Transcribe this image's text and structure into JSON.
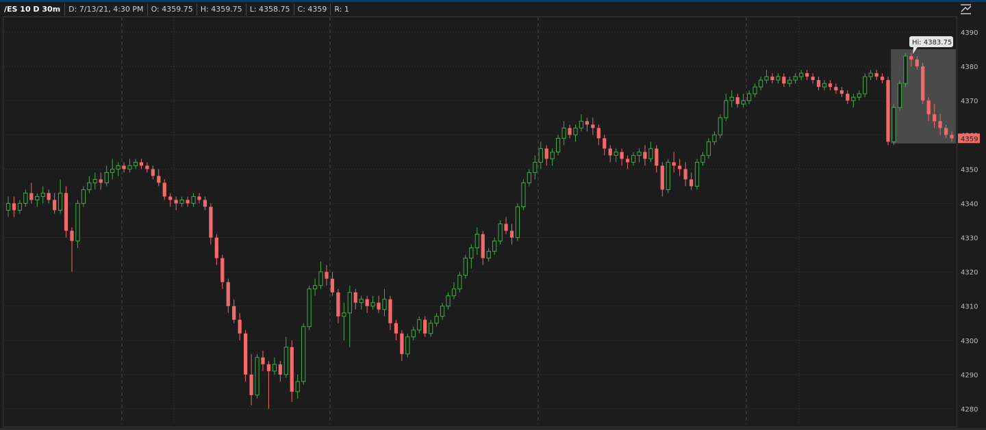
{
  "header": {
    "symbol": "/ES 10 D 30m",
    "date": "D: 7/13/21, 4:30 PM",
    "open": "O: 4359.75",
    "high": "H: 4359.75",
    "low": "L: 4358.75",
    "close": "C: 4359",
    "range": "R: 1"
  },
  "icons": {
    "corner": "chart-settings-icon"
  },
  "colors": {
    "background": "#1c1c1c",
    "up": "#3cb043",
    "down": "#f06a6a",
    "grid": "#3c3c3c",
    "highlight": "#5a5a5a"
  },
  "hi_label": "Hi: 4383.75",
  "last_price_label": "4359",
  "chart_data": {
    "type": "candlestick",
    "title": "/ES 10 D 30m",
    "ylim": [
      4278,
      4393
    ],
    "y_ticks": [
      "4390",
      "4380",
      "4370",
      "4360",
      "4350",
      "4340",
      "4330",
      "4320",
      "4310",
      "4300",
      "4290",
      "4280"
    ],
    "grid": "dotted horizontal, dashed vertical day separators",
    "candles": [
      [
        4338,
        4342,
        4336,
        4340
      ],
      [
        4340,
        4342,
        4336,
        4338
      ],
      [
        4338,
        4341,
        4337,
        4340
      ],
      [
        4340,
        4344,
        4339,
        4343
      ],
      [
        4343,
        4346,
        4340,
        4341
      ],
      [
        4341,
        4343,
        4339,
        4342
      ],
      [
        4342,
        4345,
        4340,
        4343
      ],
      [
        4343,
        4344,
        4340,
        4341
      ],
      [
        4341,
        4343,
        4337,
        4338
      ],
      [
        4338,
        4347,
        4337,
        4343
      ],
      [
        4343,
        4345,
        4330,
        4332
      ],
      [
        4332,
        4333,
        4320,
        4329
      ],
      [
        4329,
        4341,
        4327,
        4340
      ],
      [
        4340,
        4345,
        4339,
        4344
      ],
      [
        4344,
        4348,
        4343,
        4346
      ],
      [
        4346,
        4349,
        4344,
        4347
      ],
      [
        4347,
        4349,
        4344,
        4346
      ],
      [
        4346,
        4351,
        4345,
        4349
      ],
      [
        4349,
        4353,
        4347,
        4350
      ],
      [
        4350,
        4352,
        4348,
        4351
      ],
      [
        4351,
        4352,
        4349,
        4350
      ],
      [
        4350,
        4353,
        4349,
        4351
      ],
      [
        4351,
        4353,
        4350,
        4352
      ],
      [
        4352,
        4353,
        4350,
        4351
      ],
      [
        4351,
        4352,
        4349,
        4350
      ],
      [
        4350,
        4351,
        4347,
        4348
      ],
      [
        4348,
        4350,
        4345,
        4346
      ],
      [
        4346,
        4347,
        4341,
        4342
      ],
      [
        4342,
        4343,
        4339,
        4341
      ],
      [
        4341,
        4342,
        4338,
        4340
      ],
      [
        4340,
        4342,
        4339,
        4341
      ],
      [
        4341,
        4342,
        4339,
        4340
      ],
      [
        4340,
        4343,
        4339,
        4342
      ],
      [
        4342,
        4343,
        4340,
        4341
      ],
      [
        4341,
        4342,
        4338,
        4339
      ],
      [
        4339,
        4340,
        4328,
        4330
      ],
      [
        4330,
        4331,
        4322,
        4324
      ],
      [
        4324,
        4325,
        4315,
        4317
      ],
      [
        4317,
        4318,
        4308,
        4310
      ],
      [
        4310,
        4312,
        4305,
        4306
      ],
      [
        4306,
        4308,
        4300,
        4302
      ],
      [
        4302,
        4303,
        4288,
        4290
      ],
      [
        4290,
        4296,
        4281,
        4284
      ],
      [
        4284,
        4296,
        4283,
        4295
      ],
      [
        4295,
        4297,
        4291,
        4293
      ],
      [
        4293,
        4294,
        4280,
        4291
      ],
      [
        4291,
        4295,
        4290,
        4293
      ],
      [
        4293,
        4294,
        4288,
        4290
      ],
      [
        4290,
        4301,
        4289,
        4298
      ],
      [
        4298,
        4300,
        4282,
        4285
      ],
      [
        4285,
        4290,
        4283,
        4288
      ],
      [
        4288,
        4305,
        4287,
        4304
      ],
      [
        4304,
        4316,
        4303,
        4315
      ],
      [
        4315,
        4318,
        4313,
        4316
      ],
      [
        4316,
        4323,
        4315,
        4320
      ],
      [
        4320,
        4322,
        4316,
        4318
      ],
      [
        4318,
        4320,
        4313,
        4314
      ],
      [
        4314,
        4315,
        4305,
        4307
      ],
      [
        4307,
        4311,
        4300,
        4308
      ],
      [
        4308,
        4316,
        4298,
        4314
      ],
      [
        4314,
        4315,
        4309,
        4311
      ],
      [
        4311,
        4313,
        4309,
        4312
      ],
      [
        4312,
        4313,
        4308,
        4310
      ],
      [
        4310,
        4313,
        4309,
        4311
      ],
      [
        4311,
        4313,
        4308,
        4309
      ],
      [
        4309,
        4315,
        4307,
        4312
      ],
      [
        4312,
        4313,
        4303,
        4305
      ],
      [
        4305,
        4306,
        4300,
        4302
      ],
      [
        4302,
        4303,
        4294,
        4296
      ],
      [
        4296,
        4302,
        4295,
        4301
      ],
      [
        4301,
        4304,
        4300,
        4303
      ],
      [
        4303,
        4307,
        4302,
        4306
      ],
      [
        4306,
        4307,
        4301,
        4302
      ],
      [
        4302,
        4306,
        4301,
        4305
      ],
      [
        4305,
        4308,
        4304,
        4307
      ],
      [
        4307,
        4311,
        4306,
        4310
      ],
      [
        4310,
        4314,
        4309,
        4313
      ],
      [
        4313,
        4317,
        4312,
        4315
      ],
      [
        4315,
        4320,
        4314,
        4319
      ],
      [
        4319,
        4325,
        4318,
        4324
      ],
      [
        4324,
        4328,
        4321,
        4327
      ],
      [
        4327,
        4333,
        4325,
        4331
      ],
      [
        4331,
        4332,
        4322,
        4324
      ],
      [
        4324,
        4327,
        4323,
        4326
      ],
      [
        4326,
        4330,
        4325,
        4329
      ],
      [
        4329,
        4335,
        4328,
        4334
      ],
      [
        4334,
        4336,
        4331,
        4332
      ],
      [
        4332,
        4334,
        4328,
        4330
      ],
      [
        4330,
        4340,
        4329,
        4339
      ],
      [
        4339,
        4347,
        4338,
        4346
      ],
      [
        4346,
        4350,
        4345,
        4349
      ],
      [
        4349,
        4354,
        4347,
        4352
      ],
      [
        4352,
        4358,
        4350,
        4356
      ],
      [
        4356,
        4357,
        4351,
        4353
      ],
      [
        4353,
        4356,
        4351,
        4355
      ],
      [
        4355,
        4360,
        4354,
        4359
      ],
      [
        4359,
        4364,
        4357,
        4362
      ],
      [
        4362,
        4363,
        4359,
        4360
      ],
      [
        4360,
        4363,
        4358,
        4362
      ],
      [
        4362,
        4366,
        4361,
        4364
      ],
      [
        4364,
        4365,
        4361,
        4363
      ],
      [
        4363,
        4365,
        4360,
        4362
      ],
      [
        4362,
        4363,
        4357,
        4359
      ],
      [
        4359,
        4360,
        4354,
        4356
      ],
      [
        4356,
        4357,
        4352,
        4354
      ],
      [
        4354,
        4356,
        4352,
        4355
      ],
      [
        4355,
        4356,
        4351,
        4353
      ],
      [
        4353,
        4354,
        4350,
        4352
      ],
      [
        4352,
        4355,
        4351,
        4354
      ],
      [
        4354,
        4356,
        4352,
        4355
      ],
      [
        4355,
        4357,
        4351,
        4353
      ],
      [
        4353,
        4358,
        4352,
        4356
      ],
      [
        4356,
        4357,
        4349,
        4351
      ],
      [
        4351,
        4352,
        4342,
        4344
      ],
      [
        4344,
        4353,
        4343,
        4352
      ],
      [
        4352,
        4355,
        4349,
        4351
      ],
      [
        4351,
        4353,
        4348,
        4350
      ],
      [
        4350,
        4352,
        4345,
        4347
      ],
      [
        4347,
        4349,
        4344,
        4345
      ],
      [
        4345,
        4353,
        4344,
        4352
      ],
      [
        4352,
        4355,
        4351,
        4354
      ],
      [
        4354,
        4359,
        4353,
        4358
      ],
      [
        4358,
        4361,
        4357,
        4360
      ],
      [
        4360,
        4366,
        4359,
        4365
      ],
      [
        4365,
        4372,
        4364,
        4370
      ],
      [
        4370,
        4373,
        4368,
        4371
      ],
      [
        4371,
        4372,
        4368,
        4369
      ],
      [
        4369,
        4372,
        4368,
        4370
      ],
      [
        4370,
        4373,
        4369,
        4372
      ],
      [
        4372,
        4375,
        4371,
        4374
      ],
      [
        4374,
        4377,
        4373,
        4376
      ],
      [
        4376,
        4379,
        4375,
        4377
      ],
      [
        4377,
        4378,
        4375,
        4376
      ],
      [
        4376,
        4378,
        4375,
        4377
      ],
      [
        4377,
        4378,
        4374,
        4375
      ],
      [
        4375,
        4377,
        4374,
        4376
      ],
      [
        4376,
        4378,
        4375,
        4377
      ],
      [
        4377,
        4379,
        4376,
        4378
      ],
      [
        4378,
        4379,
        4376,
        4377
      ],
      [
        4377,
        4378,
        4375,
        4376
      ],
      [
        4376,
        4377,
        4373,
        4374
      ],
      [
        4374,
        4376,
        4373,
        4375
      ],
      [
        4375,
        4376,
        4373,
        4374
      ],
      [
        4374,
        4375,
        4372,
        4373
      ],
      [
        4373,
        4374,
        4371,
        4372
      ],
      [
        4372,
        4373,
        4369,
        4370
      ],
      [
        4370,
        4372,
        4368,
        4371
      ],
      [
        4371,
        4373,
        4370,
        4372
      ],
      [
        4372,
        4378,
        4371,
        4377
      ],
      [
        4377,
        4379,
        4376,
        4378
      ],
      [
        4378,
        4379,
        4376,
        4377
      ],
      [
        4377,
        4378,
        4375,
        4376
      ],
      [
        4376,
        4377,
        4357,
        4358
      ],
      [
        4358,
        4369,
        4357,
        4368
      ],
      [
        4368,
        4376,
        4367,
        4375
      ],
      [
        4375,
        4384,
        4374,
        4383
      ],
      [
        4383,
        4384,
        4380,
        4382
      ],
      [
        4382,
        4383,
        4379,
        4380
      ],
      [
        4380,
        4381,
        4369,
        4370
      ],
      [
        4370,
        4371,
        4364,
        4366
      ],
      [
        4366,
        4369,
        4362,
        4364
      ],
      [
        4364,
        4366,
        4360,
        4362
      ],
      [
        4362,
        4363,
        4359,
        4360
      ],
      [
        4360,
        4361,
        4358,
        4359
      ]
    ]
  }
}
